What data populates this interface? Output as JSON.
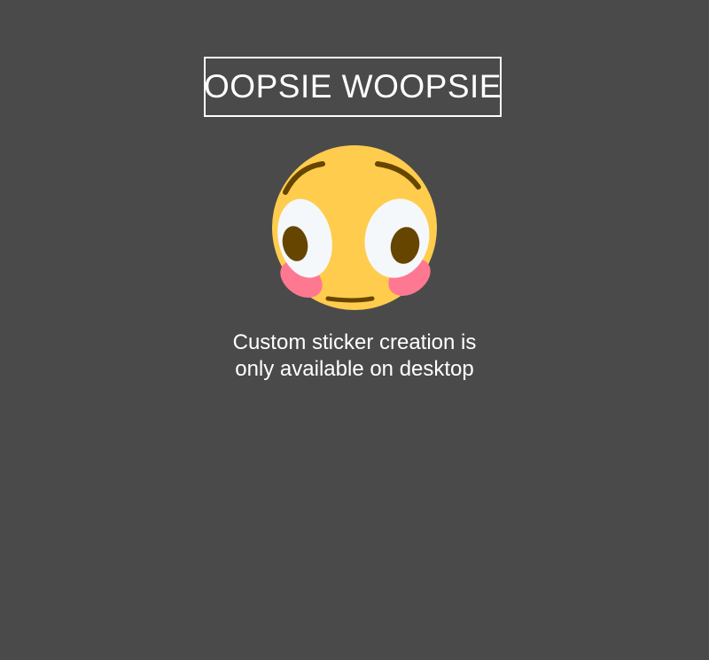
{
  "heading": {
    "title": "OOPSIE WOOPSIE"
  },
  "illustration": {
    "icon": "flushed-face-icon",
    "colors": {
      "face": "#ffcc4d",
      "eye_white": "#f5f8fa",
      "pupil": "#664500",
      "blush": "#ff7892",
      "background": "#4a4a4a"
    }
  },
  "message": {
    "line1": "Custom sticker creation is",
    "line2": "only available on desktop"
  }
}
